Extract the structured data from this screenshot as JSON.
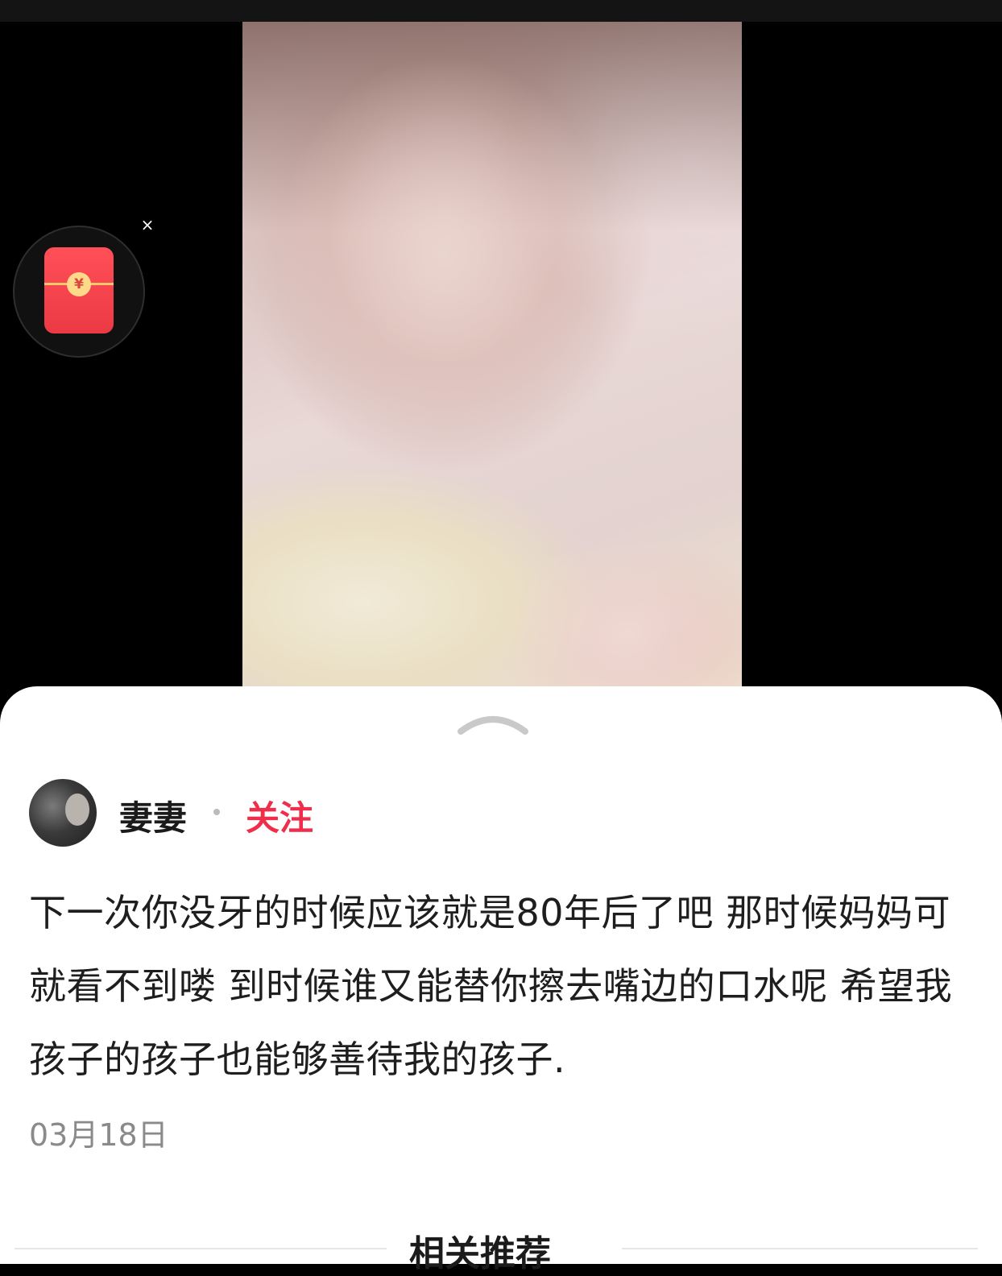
{
  "redpacket": {
    "coin_symbol": "¥",
    "close_symbol": "×"
  },
  "post": {
    "author": "妻妻",
    "separator": "·",
    "follow_label": "关注",
    "text": "下一次你没牙的时候应该就是80年后了吧 那时候妈妈可就看不到喽 到时候谁又能替你擦去嘴边的口水呢 希望我孩子的孩子也能够善待我的孩子.",
    "date": "03月18日"
  },
  "related": {
    "title": "相关推荐"
  },
  "colors": {
    "accent": "#ee2e4a",
    "sheet_bg": "#ffffff",
    "media_bg": "#000000"
  }
}
